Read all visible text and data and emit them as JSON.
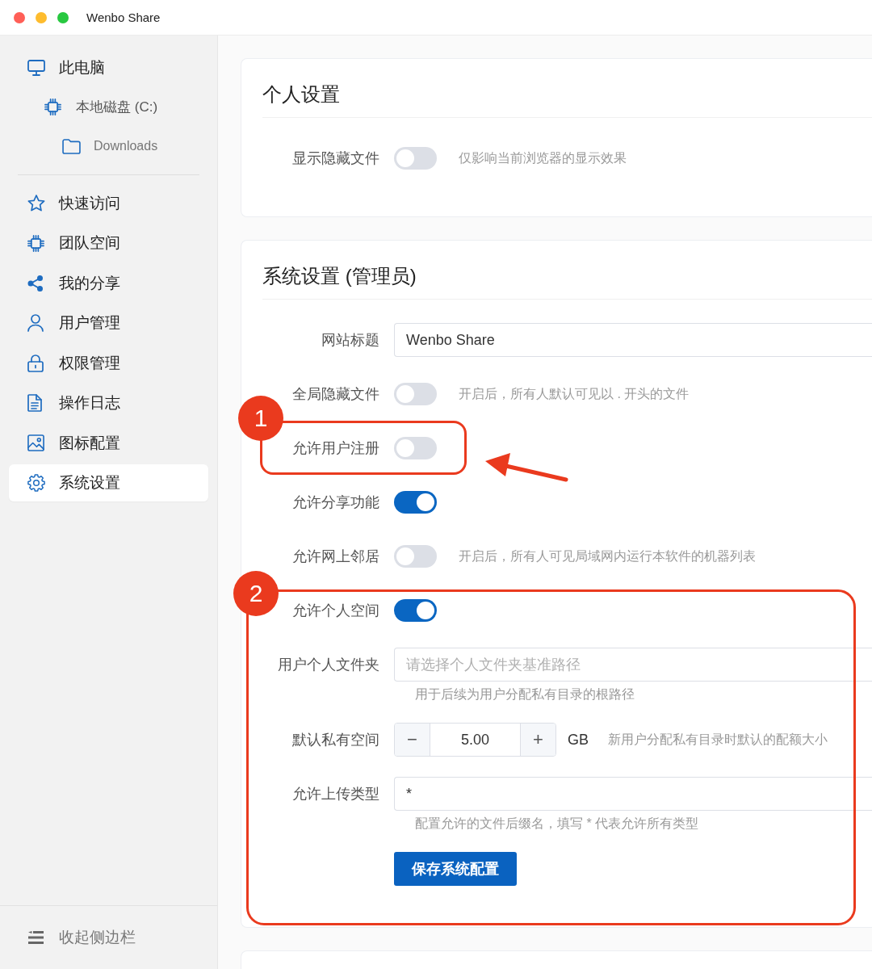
{
  "window": {
    "title": "Wenbo Share"
  },
  "sidebar": {
    "tree": [
      {
        "label": "此电脑",
        "children": [
          {
            "label": "本地磁盘 (C:)",
            "children": [
              {
                "label": "Downloads"
              }
            ]
          }
        ]
      }
    ],
    "items": [
      {
        "label": "快速访问",
        "selected": false
      },
      {
        "label": "团队空间",
        "selected": false
      },
      {
        "label": "我的分享",
        "selected": false
      },
      {
        "label": "用户管理",
        "selected": false
      },
      {
        "label": "权限管理",
        "selected": false
      },
      {
        "label": "操作日志",
        "selected": false
      },
      {
        "label": "图标配置",
        "selected": false
      },
      {
        "label": "系统设置",
        "selected": true
      }
    ],
    "collapse": {
      "label": "收起侧边栏"
    }
  },
  "personal_settings": {
    "title": "个人设置",
    "rows": [
      {
        "kind": "toggle",
        "label": "显示隐藏文件",
        "on": false,
        "hint": "仅影响当前浏览器的显示效果"
      }
    ]
  },
  "system_settings": {
    "title": "系统设置 (管理员)",
    "rows": [
      {
        "kind": "text",
        "label": "网站标题",
        "value": "Wenbo Share"
      },
      {
        "kind": "toggle",
        "label": "全局隐藏文件",
        "on": false,
        "hint": "开启后，所有人默认可见以 . 开头的文件"
      },
      {
        "kind": "toggle",
        "label": "允许用户注册",
        "on": false
      },
      {
        "kind": "toggle",
        "label": "允许分享功能",
        "on": true
      },
      {
        "kind": "toggle",
        "label": "允许网上邻居",
        "on": false,
        "hint": "开启后，所有人可见局域网内运行本软件的机器列表"
      },
      {
        "kind": "toggle",
        "label": "允许个人空间",
        "on": true
      },
      {
        "kind": "text",
        "label": "用户个人文件夹",
        "placeholder": "请选择个人文件夹基准路径",
        "help": "用于后续为用户分配私有目录的根路径"
      },
      {
        "kind": "number",
        "label": "默认私有空间",
        "decrement": "−",
        "value": "5.00",
        "increment": "+",
        "unit": "GB",
        "hint": "新用户分配私有目录时默认的配额大小"
      },
      {
        "kind": "text",
        "label": "允许上传类型",
        "value": "*",
        "help": "配置允许的文件后缀名，填写 * 代表允许所有类型"
      },
      {
        "kind": "button",
        "label": "保存系统配置"
      }
    ]
  },
  "annotations": [
    {
      "label": "1",
      "arrow": true
    },
    {
      "label": "2",
      "arrow": false
    }
  ]
}
